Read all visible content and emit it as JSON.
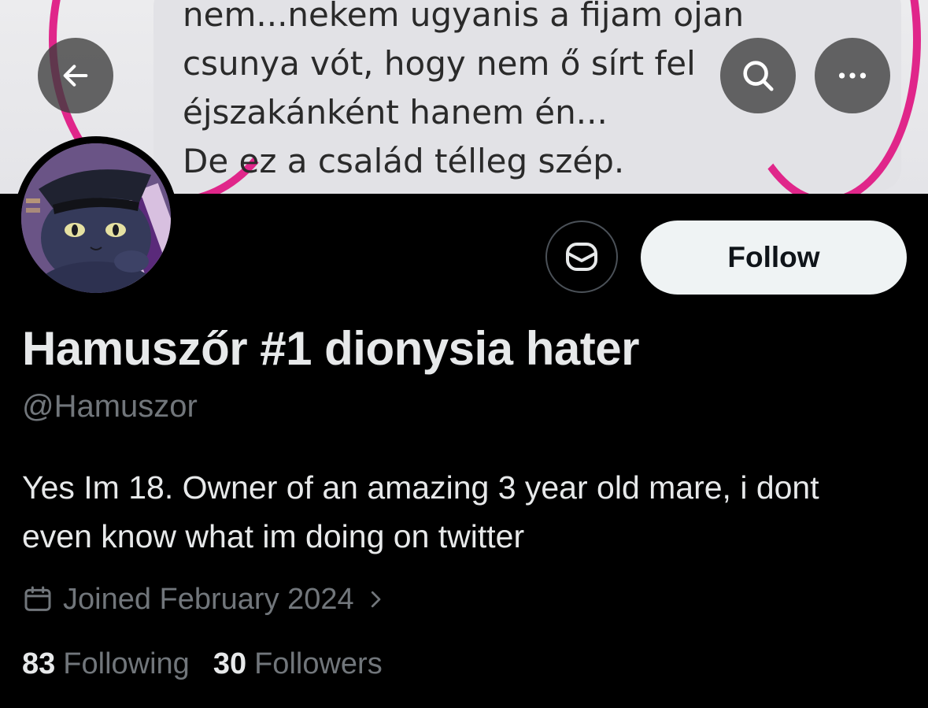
{
  "banner": {
    "lines": [
      "nem...nekem ugyanis a fijam ojan",
      "csunya vót, hogy nem ő sírt fel",
      "éjszakánként hanem én...",
      "De ez a család télleg szép."
    ],
    "heart_color": "#e0268a"
  },
  "nav": {
    "back_icon": "arrow-left-icon",
    "search_icon": "search-icon",
    "more_icon": "more-horizontal-icon"
  },
  "actions": {
    "message_icon": "envelope-icon",
    "follow_label": "Follow"
  },
  "profile": {
    "display_name": "Hamuszőr #1 dionysia hater",
    "handle": "@Hamuszor",
    "bio": "Yes Im 18. Owner of an amazing 3 year old mare, i dont even know what im doing on twitter",
    "joined": "Joined February 2024"
  },
  "stats": {
    "following_count": "83",
    "following_label": "Following",
    "followers_count": "30",
    "followers_label": "Followers"
  },
  "colors": {
    "background": "#000000",
    "text_primary": "#e7e9ea",
    "text_secondary": "#71767b",
    "follow_button_bg": "#eff3f4"
  }
}
